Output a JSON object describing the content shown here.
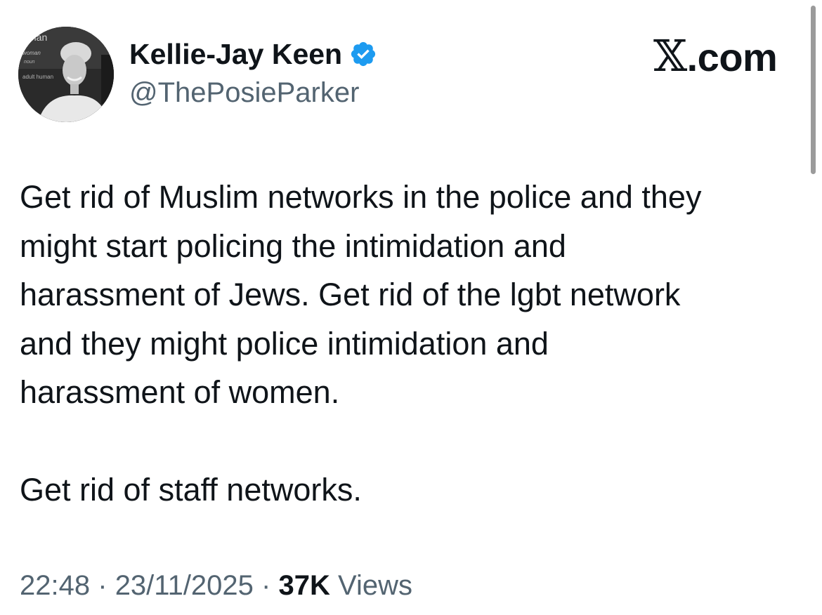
{
  "author": {
    "display_name": "Kellie-Jay Keen",
    "handle": "@ThePosieParker",
    "verified": true,
    "avatar_text": [
      "man",
      "woman",
      "noun",
      "adult human"
    ]
  },
  "brand": {
    "x_glyph": "𝕏",
    "suffix": ".com"
  },
  "tweet": {
    "lines": [
      "Get rid of Muslim networks in the police and they",
      "might start policing the intimidation and",
      "harassment of Jews.  Get rid of the lgbt network",
      "and they might police intimidation and",
      "harassment of women.",
      "",
      "Get rid of staff networks."
    ]
  },
  "meta": {
    "time": "22:48",
    "separator": "·",
    "date": "23/11/2025",
    "views_count": "37K",
    "views_label": "Views"
  },
  "colors": {
    "text_primary": "#0f1419",
    "text_secondary": "#536471",
    "verified_blue": "#1d9bf0"
  },
  "icons": {
    "verified": "verified-badge-icon"
  }
}
